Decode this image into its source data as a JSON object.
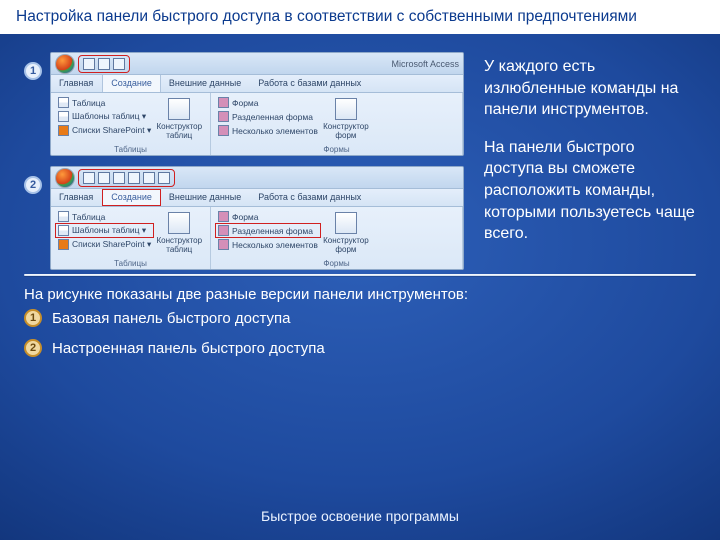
{
  "title": "Настройка панели быстрого доступа в соответствии с собственными предпочтениями",
  "callouts": {
    "num1": "1",
    "num2": "2"
  },
  "ribbon": {
    "app_title": "Microsoft Access",
    "tabs": {
      "home": "Главная",
      "create": "Создание",
      "external": "Внешние данные",
      "dbtools": "Работа с базами данных"
    },
    "group_tables": {
      "label": "Таблицы",
      "btn_table": "Таблица",
      "btn_templates": "Шаблоны таблиц ▾",
      "btn_sp": "Списки SharePoint ▾",
      "btn_designer": "Конструктор таблиц"
    },
    "group_forms": {
      "label": "Формы",
      "btn_form": "Форма",
      "btn_split": "Разделенная форма",
      "btn_multi": "Несколько элементов",
      "btn_designer": "Конструктор форм"
    }
  },
  "side_text": {
    "p1": "У каждого есть излюбленные команды на панели инструментов.",
    "p2": "На панели быстрого доступа вы сможете расположить команды, которыми пользуетесь чаще всего."
  },
  "caption": "На рисунке показаны две разные версии панели инструментов:",
  "legend": {
    "n1": "1",
    "t1": "Базовая панель быстрого доступа",
    "n2": "2",
    "t2": "Настроенная панель быстрого доступа"
  },
  "footer": "Быстрое освоение программы"
}
